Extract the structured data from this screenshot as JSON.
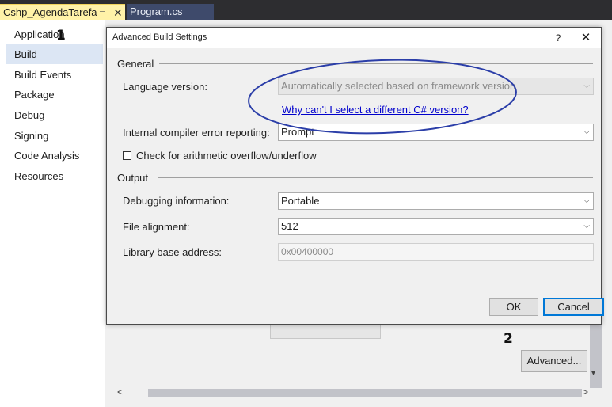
{
  "tabs": [
    {
      "label": "Cshp_AgendaTarefa",
      "active": true,
      "pin_glyph": "⊣",
      "close_glyph": "✕"
    },
    {
      "label": "Program.cs",
      "active": false
    }
  ],
  "sidebar": {
    "items": [
      {
        "label": "Application"
      },
      {
        "label": "Build",
        "selected": true
      },
      {
        "label": "Build Events"
      },
      {
        "label": "Package"
      },
      {
        "label": "Debug"
      },
      {
        "label": "Signing"
      },
      {
        "label": "Code Analysis"
      },
      {
        "label": "Resources"
      }
    ]
  },
  "callouts": {
    "one": "1",
    "two": "2"
  },
  "background": {
    "advanced_button": "Advanced...",
    "scroll_left": "<",
    "scroll_right": ">",
    "scroll_down": "▾"
  },
  "dialog": {
    "title": "Advanced Build Settings",
    "help": "?",
    "close": "✕",
    "general": {
      "heading": "General",
      "language_version": {
        "label": "Language version:",
        "value": "Automatically selected based on framework version",
        "disabled": true
      },
      "why_link": "Why can't I select a different C# version?",
      "compiler_error_reporting": {
        "label": "Internal compiler error reporting:",
        "value": "Prompt"
      },
      "overflow_check": {
        "label": "Check for arithmetic overflow/underflow",
        "checked": false
      }
    },
    "output": {
      "heading": "Output",
      "debugging_information": {
        "label": "Debugging information:",
        "value": "Portable"
      },
      "file_alignment": {
        "label": "File alignment:",
        "value": "512"
      },
      "library_base_address": {
        "label": "Library base address:",
        "value": "0x00400000"
      }
    },
    "buttons": {
      "ok": "OK",
      "cancel": "Cancel"
    }
  },
  "icons": {
    "dropdown": "chevron-down-icon",
    "close": "close-icon",
    "help": "help-icon",
    "pin": "pin-icon"
  },
  "colors": {
    "active_tab": "#fff2a8",
    "inactive_tab": "#3e4a6b",
    "selected_nav": "#dce6f4",
    "link": "#0000cc",
    "annotation_ellipse": "#2b3ea8",
    "focus_border": "#0078d7"
  }
}
